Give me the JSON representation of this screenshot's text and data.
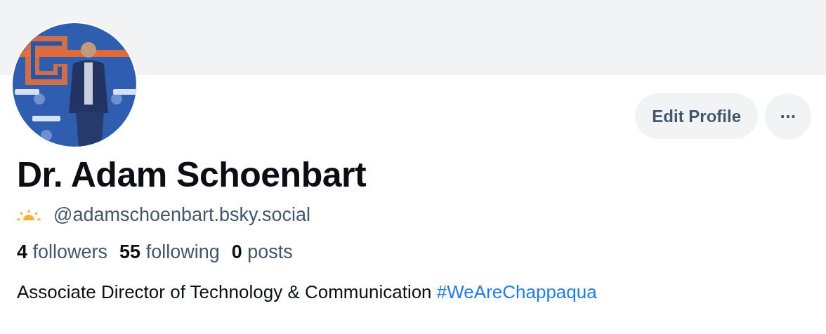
{
  "profile": {
    "buttons": [
      {
        "kind": "text",
        "label": "Edit Profile"
      },
      {
        "kind": "more",
        "label": "···"
      }
    ],
    "display_name": "Dr. Adam Schoenbart",
    "handle": "@adamschoenbart.bsky.social",
    "stats": [
      {
        "count": "4",
        "label": "followers"
      },
      {
        "count": "55",
        "label": "following"
      },
      {
        "count": "0",
        "label": "posts"
      }
    ],
    "bio": {
      "text": "Associate Director of Technology & Communication",
      "hashtag": "#WeAreChappaqua"
    }
  }
}
